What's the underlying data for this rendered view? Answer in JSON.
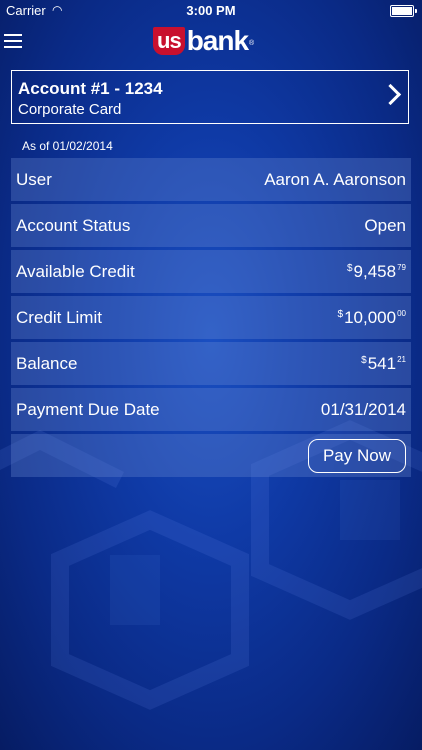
{
  "status_bar": {
    "carrier": "Carrier",
    "time": "3:00 PM"
  },
  "nav": {
    "logo_us": "us",
    "logo_bank": "bank"
  },
  "account": {
    "title": "Account #1 - 1234",
    "subtitle": "Corporate Card"
  },
  "as_of": "As of 01/02/2014",
  "rows": {
    "user": {
      "label": "User",
      "value": "Aaron A. Aaronson"
    },
    "status": {
      "label": "Account Status",
      "value": "Open"
    },
    "available_credit": {
      "label": "Available Credit",
      "currency": "$",
      "whole": "9,458",
      "cents": "79"
    },
    "credit_limit": {
      "label": "Credit Limit",
      "currency": "$",
      "whole": "10,000",
      "cents": "00"
    },
    "balance": {
      "label": "Balance",
      "currency": "$",
      "whole": "541",
      "cents": "21"
    },
    "due_date": {
      "label": "Payment Due Date",
      "value": "01/31/2014"
    }
  },
  "actions": {
    "pay_now": "Pay Now"
  },
  "colors": {
    "brand_red": "#c8102e",
    "bg_blue": "#0f3aa6"
  }
}
